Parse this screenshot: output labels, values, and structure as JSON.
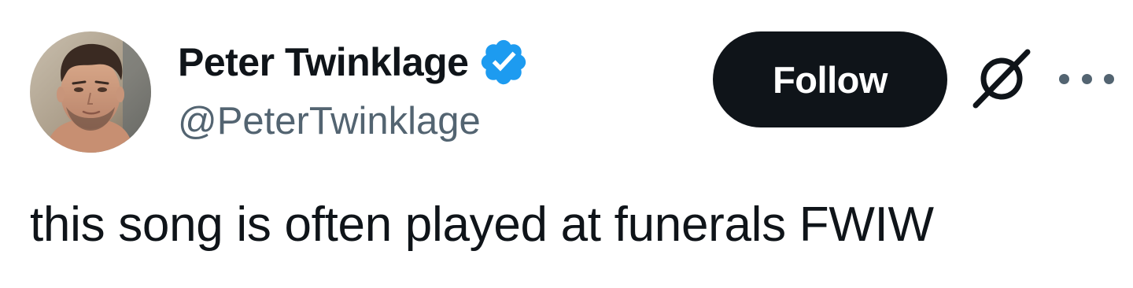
{
  "author": {
    "display_name": "Peter Twinklage",
    "handle": "@PeterTwinklage",
    "verified": true,
    "verified_color": "#1d9bf0",
    "avatar_icon": "profile-photo"
  },
  "actions": {
    "follow_label": "Follow",
    "grok_icon": "grok-icon",
    "more_icon": "more-options-icon"
  },
  "tweet": {
    "text": "this song is often played at funerals FWIW"
  },
  "colors": {
    "primary_text": "#0f1419",
    "secondary_text": "#536471",
    "button_bg": "#0f1419",
    "button_text": "#ffffff"
  }
}
